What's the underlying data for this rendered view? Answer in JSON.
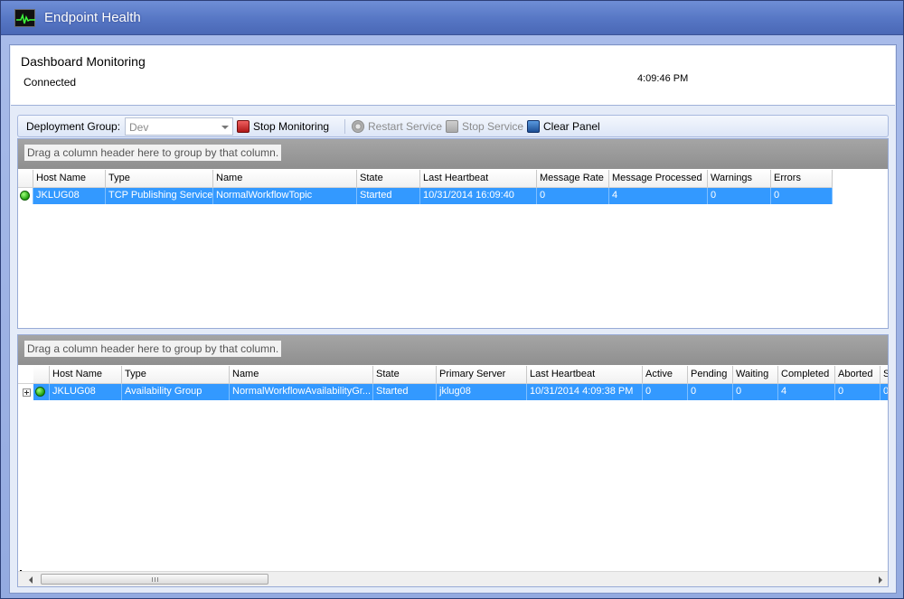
{
  "window": {
    "title": "Endpoint Health"
  },
  "header": {
    "title": "Dashboard Monitoring",
    "status": "Connected",
    "time": "4:09:46 PM"
  },
  "toolbar": {
    "deployment_group_label": "Deployment Group:",
    "deployment_group_value": "Dev",
    "stop_monitoring": "Stop Monitoring",
    "restart_service": "Restart Service",
    "stop_service": "Stop Service",
    "clear_panel": "Clear Panel"
  },
  "endpoints_grid": {
    "group_hint": "Drag a column header here to group by that column.",
    "columns": [
      "Host Name",
      "Type",
      "Name",
      "State",
      "Last Heartbeat",
      "Message Rate",
      "Message Processed",
      "Warnings",
      "Errors"
    ],
    "rows": [
      {
        "host": "JKLUG08",
        "type": "TCP Publishing Service",
        "name": "NormalWorkflowTopic",
        "state": "Started",
        "last_heartbeat": "10/31/2014 16:09:40",
        "message_rate": "0",
        "message_processed": "4",
        "warnings": "0",
        "errors": "0"
      }
    ]
  },
  "availability_grid": {
    "group_hint": "Drag a column header here to group by that column.",
    "columns": [
      "Host Name",
      "Type",
      "Name",
      "State",
      "Primary Server",
      "Last Heartbeat",
      "Active",
      "Pending",
      "Waiting",
      "Completed",
      "Aborted",
      "S"
    ],
    "rows": [
      {
        "host": "JKLUG08",
        "type": "Availability Group",
        "name": "NormalWorkflowAvailabilityGr...",
        "state": "Started",
        "primary_server": "jklug08",
        "last_heartbeat": "10/31/2014 4:09:38 PM",
        "active": "0",
        "pending": "0",
        "waiting": "0",
        "completed": "4",
        "aborted": "0",
        "extra": "0"
      }
    ]
  },
  "icons": {
    "app": "heartbeat-monitor-icon",
    "status": "green-status-icon"
  },
  "colors": {
    "title_bar": "#5676c4",
    "selected_row": "#3399ff",
    "stop_red": "#c02020",
    "clear_blue": "#1e4f96"
  }
}
